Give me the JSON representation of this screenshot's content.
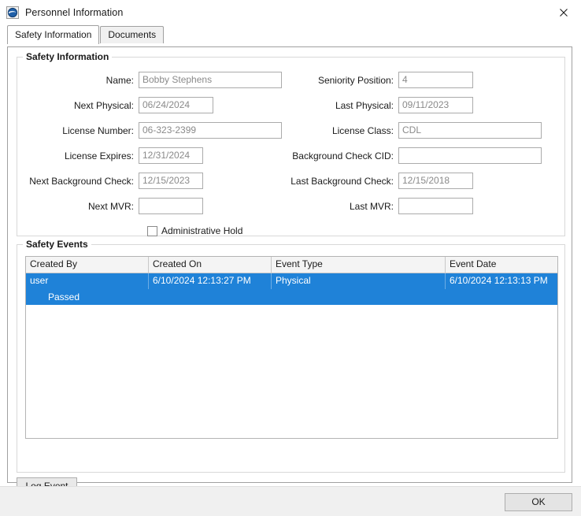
{
  "window": {
    "title": "Personnel Information",
    "icon": "app-globe-icon",
    "close_label": "close-icon"
  },
  "tabs": [
    {
      "label": "Safety Information",
      "active": true
    },
    {
      "label": "Documents",
      "active": false
    }
  ],
  "safety_information": {
    "group_title": "Safety Information",
    "left_fields": [
      {
        "label": "Name:",
        "value": "Bobby Stephens",
        "placeholder": "",
        "width": "long"
      },
      {
        "label": "Next Physical:",
        "value": "06/24/2024",
        "placeholder": "",
        "width": "med"
      },
      {
        "label": "License Number:",
        "value": "06-323-2399",
        "placeholder": "",
        "width": "long"
      },
      {
        "label": "License Expires:",
        "value": "12/31/2024",
        "placeholder": "",
        "width": "short"
      },
      {
        "label": "Next Background Check:",
        "value": "12/15/2023",
        "placeholder": "",
        "width": "short"
      },
      {
        "label": "Next MVR:",
        "value": "",
        "placeholder": "",
        "width": "short"
      }
    ],
    "right_fields": [
      {
        "label": "Seniority Position:",
        "value": "4",
        "placeholder": "",
        "width": "med"
      },
      {
        "label": "Last Physical:",
        "value": "09/11/2023",
        "placeholder": "",
        "width": "med"
      },
      {
        "label": "License Class:",
        "value": "CDL",
        "placeholder": "",
        "width": "long"
      },
      {
        "label": "Background Check CID:",
        "value": "",
        "placeholder": "",
        "width": "long"
      },
      {
        "label": "Last Background Check:",
        "value": "12/15/2018",
        "placeholder": "",
        "width": "med"
      },
      {
        "label": "Last MVR:",
        "value": "",
        "placeholder": "",
        "width": "med"
      }
    ],
    "administrative_hold": {
      "label": "Administrative Hold",
      "checked": false
    }
  },
  "safety_events": {
    "group_title": "Safety Events",
    "columns": [
      "Created By",
      "Created On",
      "Event Type",
      "Event Date"
    ],
    "rows": [
      {
        "selected": true,
        "cells": [
          "user",
          "6/10/2024 12:13:27 PM",
          "Physical",
          "6/10/2024 12:13:13 PM"
        ],
        "detail": "Passed"
      }
    ],
    "log_event_label": "Log Event"
  },
  "footer": {
    "ok_label": "OK"
  },
  "colors": {
    "selection_blue": "#1f82d8",
    "window_bg": "#ffffff",
    "footer_bg": "#f0f0f0",
    "readonly_text": "#8a8a8a"
  }
}
